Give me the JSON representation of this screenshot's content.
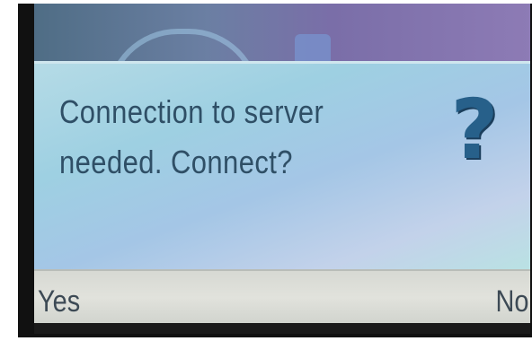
{
  "dialog": {
    "message_line1": "Connection to server",
    "message_line2": "needed. Connect?",
    "icon": "question-mark-icon",
    "icon_glyph": "?"
  },
  "softkeys": {
    "left_label": "Yes",
    "right_label": "No"
  },
  "colors": {
    "dialog_text": "#2f4f66",
    "icon": "#27608a",
    "softkey_bar": "#e1e2dc"
  }
}
